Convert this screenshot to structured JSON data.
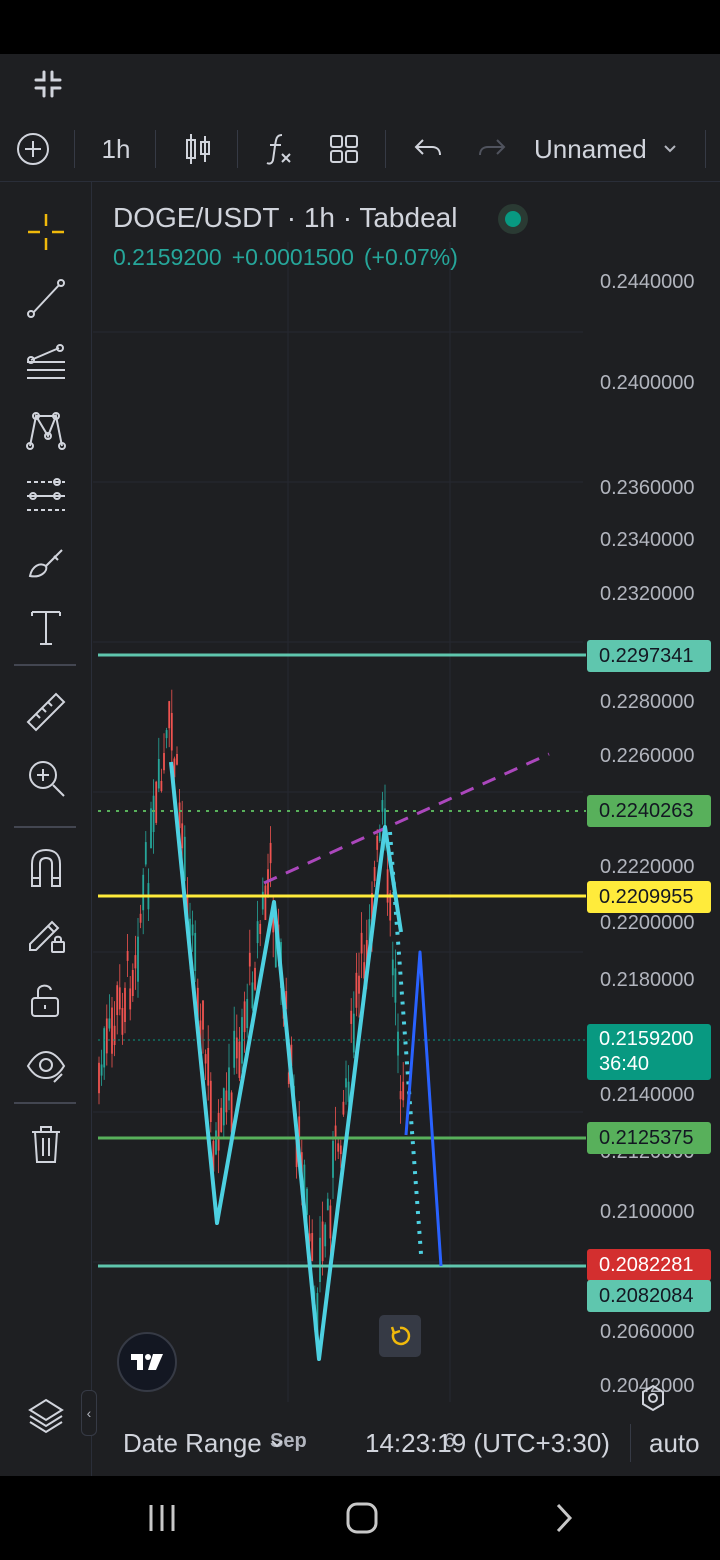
{
  "toolbar": {
    "interval": "1h",
    "layout_name": "Unnamed"
  },
  "legend": {
    "symbol_line": "DOGE/USDT · 1h · Tabdeal",
    "last_price": "0.2159200",
    "change": "+0.0001500",
    "change_pct": "(+0.07%)",
    "status_color": "#089981"
  },
  "price_axis": {
    "ticks": [
      "0.2440000",
      "0.2400000",
      "0.2360000",
      "0.2340000",
      "0.2320000",
      "0.2280000",
      "0.2260000",
      "0.2220000",
      "0.2200000",
      "0.2180000",
      "0.2140000",
      "0.2120000",
      "0.2100000",
      "0.2060000",
      "0.2042000"
    ],
    "tags": [
      {
        "text": "0.2297341",
        "bg": "#5fc6ae",
        "fg": "#131722"
      },
      {
        "text": "0.2240263",
        "bg": "#58b05b",
        "fg": "#131722"
      },
      {
        "text": "0.2209955",
        "bg": "#ffeb3b",
        "fg": "#131722"
      },
      {
        "text": "0.2159200",
        "text2": "36:40",
        "bg": "#089981",
        "fg": "#ffffff"
      },
      {
        "text": "0.2125375",
        "bg": "#58b05b",
        "fg": "#131722"
      },
      {
        "text": "0.2082281",
        "bg": "#d32f2f",
        "fg": "#ffffff"
      },
      {
        "text": "0.2082084",
        "bg": "#5fc6ae",
        "fg": "#131722"
      }
    ]
  },
  "time_axis": {
    "labels": [
      "Sep",
      "6"
    ]
  },
  "bottom_bar": {
    "date_range": "Date Range",
    "clock": "14:23:19 (UTC+3:30)",
    "auto": "auto"
  },
  "colors": {
    "background": "#1e1f22",
    "up_candle": "#26a69a",
    "down_candle": "#ef5350",
    "pattern_line": "#4dd0e1",
    "projection_line": "#2962ff",
    "trend_dashed": "#ab47bc",
    "crosshair_accent": "#f0b90b"
  }
}
